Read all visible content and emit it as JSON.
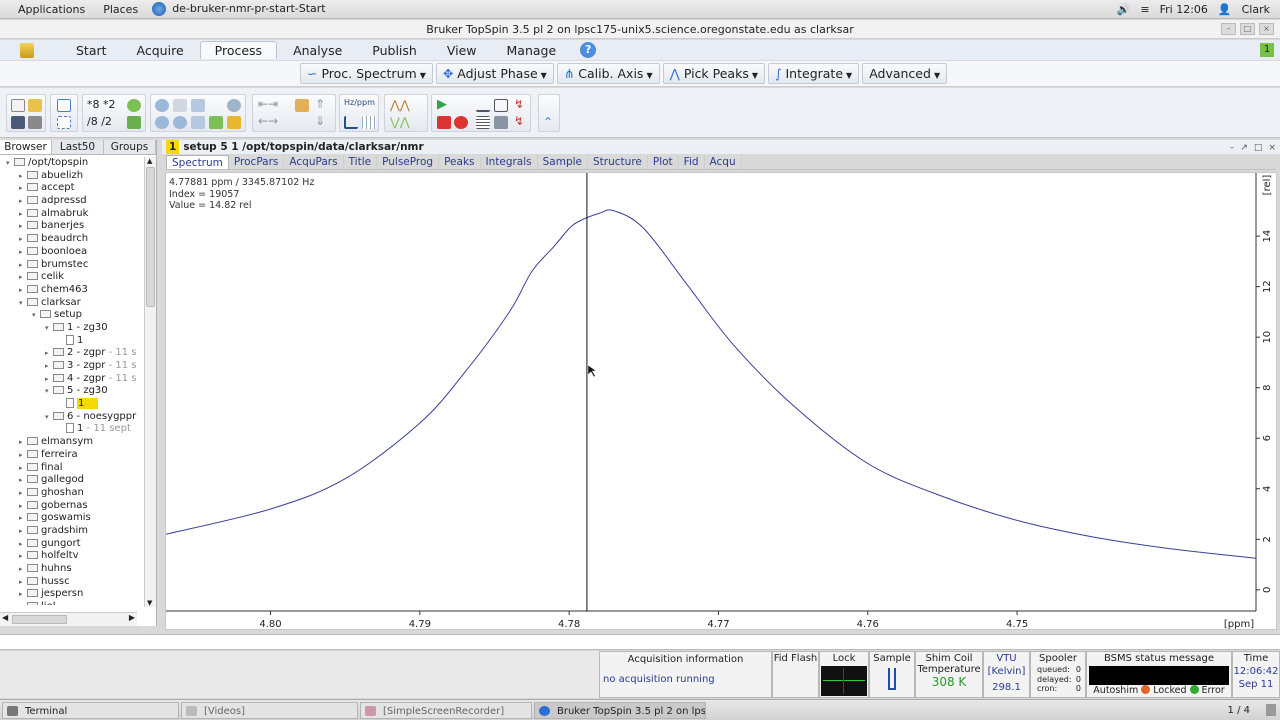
{
  "system": {
    "applications": "Applications",
    "places": "Places",
    "window_label": "de-bruker-nmr-pr-start-Start",
    "clock": "Fri 12:06",
    "user": "Clark"
  },
  "window_title": "Bruker TopSpin 3.5 pl 2 on lpsc175-unix5.science.oregonstate.edu as clarksar",
  "menu": {
    "items": [
      "Start",
      "Acquire",
      "Process",
      "Analyse",
      "Publish",
      "View",
      "Manage"
    ],
    "active": "Process",
    "help": "?",
    "corner_badge": "1"
  },
  "process_bar": [
    "Proc. Spectrum",
    "Adjust Phase",
    "Calib. Axis",
    "Pick Peaks",
    "Integrate",
    "Advanced"
  ],
  "left_tabs": [
    "Browser",
    "Last50",
    "Groups"
  ],
  "tree": [
    {
      "label": "/opt/topspin",
      "depth": 0,
      "type": "folder",
      "open": true
    },
    {
      "label": "abuelizh",
      "depth": 1,
      "type": "folder"
    },
    {
      "label": "accept",
      "depth": 1,
      "type": "folder"
    },
    {
      "label": "adpressd",
      "depth": 1,
      "type": "folder"
    },
    {
      "label": "almabruk",
      "depth": 1,
      "type": "folder"
    },
    {
      "label": "banerjes",
      "depth": 1,
      "type": "folder"
    },
    {
      "label": "beaudrch",
      "depth": 1,
      "type": "folder"
    },
    {
      "label": "boonloea",
      "depth": 1,
      "type": "folder"
    },
    {
      "label": "brumstec",
      "depth": 1,
      "type": "folder"
    },
    {
      "label": "celik",
      "depth": 1,
      "type": "folder"
    },
    {
      "label": "chem463",
      "depth": 1,
      "type": "folder"
    },
    {
      "label": "clarksar",
      "depth": 1,
      "type": "folder",
      "open": true
    },
    {
      "label": "setup",
      "depth": 2,
      "type": "folder",
      "open": true
    },
    {
      "label": "1 - zg30",
      "depth": 3,
      "type": "folder",
      "open": true
    },
    {
      "label": "1",
      "depth": 4,
      "type": "file"
    },
    {
      "label": "2 - zgpr",
      "extra": " - 11 s",
      "depth": 3,
      "type": "folder"
    },
    {
      "label": "3 - zgpr",
      "extra": " - 11 s",
      "depth": 3,
      "type": "folder"
    },
    {
      "label": "4 - zgpr",
      "extra": " - 11 s",
      "depth": 3,
      "type": "folder"
    },
    {
      "label": "5 - zg30",
      "depth": 3,
      "type": "folder",
      "open": true
    },
    {
      "label": "1",
      "depth": 4,
      "type": "file",
      "selected": true
    },
    {
      "label": "6 - noesygppr",
      "depth": 3,
      "type": "folder",
      "open": true
    },
    {
      "label": "1",
      "extra": " - 11 sept",
      "depth": 4,
      "type": "file"
    },
    {
      "label": "elmansym",
      "depth": 1,
      "type": "folder"
    },
    {
      "label": "ferreira",
      "depth": 1,
      "type": "folder"
    },
    {
      "label": "final",
      "depth": 1,
      "type": "folder"
    },
    {
      "label": "gallegod",
      "depth": 1,
      "type": "folder"
    },
    {
      "label": "ghoshan",
      "depth": 1,
      "type": "folder"
    },
    {
      "label": "gobernas",
      "depth": 1,
      "type": "folder"
    },
    {
      "label": "goswamis",
      "depth": 1,
      "type": "folder"
    },
    {
      "label": "gradshim",
      "depth": 1,
      "type": "folder"
    },
    {
      "label": "gungort",
      "depth": 1,
      "type": "folder"
    },
    {
      "label": "holfeltv",
      "depth": 1,
      "type": "folder"
    },
    {
      "label": "huhns",
      "depth": 1,
      "type": "folder"
    },
    {
      "label": "hussc",
      "depth": 1,
      "type": "folder"
    },
    {
      "label": "jespersn",
      "depth": 1,
      "type": "folder"
    },
    {
      "label": "liel",
      "depth": 1,
      "type": "folder"
    }
  ],
  "dataset": {
    "number": "1",
    "path": "setup  5  1  /opt/topspin/data/clarksar/nmr"
  },
  "data_tabs": [
    "Spectrum",
    "ProcPars",
    "AcquPars",
    "Title",
    "PulseProg",
    "Peaks",
    "Integrals",
    "Sample",
    "Structure",
    "Plot",
    "Fid",
    "Acqu"
  ],
  "cursor_info": {
    "line1": "4.77881 ppm / 3345.87102 Hz",
    "line2": "Index = 19057",
    "line3": "Value = 14.82     rel"
  },
  "chart_data": {
    "type": "line",
    "xlabel": "[ppm]",
    "ylabel": "[rel]",
    "xlim": [
      4.807,
      4.734
    ],
    "ylim": [
      -0.6,
      16.3
    ],
    "x_ticks": [
      4.8,
      4.79,
      4.78,
      4.77,
      4.76,
      4.75
    ],
    "x_tick_labels": [
      "4.80",
      "4.79",
      "4.78",
      "4.77",
      "4.76",
      "4.75"
    ],
    "y_ticks": [
      0,
      2,
      4,
      6,
      8,
      10,
      12,
      14
    ],
    "y_tick_labels": [
      "0",
      "2",
      "4",
      "6",
      "8",
      "10",
      "12",
      "14"
    ],
    "cursor_ppm": 4.77881,
    "series": [
      {
        "x": [
          4.807,
          4.8,
          4.795,
          4.79,
          4.787,
          4.784,
          4.7825,
          4.781,
          4.78,
          4.7793,
          4.778,
          4.777,
          4.775,
          4.772,
          4.769,
          4.765,
          4.76,
          4.755,
          4.75,
          4.745,
          4.74,
          4.734
        ],
        "y": [
          2.2,
          3.2,
          4.4,
          6.6,
          8.6,
          11.0,
          12.6,
          13.6,
          14.3,
          14.6,
          14.9,
          15.0,
          14.3,
          12.0,
          9.7,
          7.3,
          5.0,
          3.7,
          2.75,
          2.1,
          1.65,
          1.25
        ]
      }
    ]
  },
  "command_line": "",
  "status": {
    "acq_title": "Acquisition information",
    "acq_value": "no acquisition running",
    "fid_flash": "Fid Flash",
    "lock": "Lock",
    "sample": "Sample",
    "shim_title": "Shim Coil Temperature",
    "shim_value": "308 K",
    "vtu": "VTU",
    "vtu_unit": "[Kelvin]",
    "vtu_value": "298.1",
    "spooler": "Spooler",
    "spooler_queued": "queued:",
    "spooler_delayed": "delayed:",
    "spooler_cron": "cron:",
    "spooler_queued_val": "0",
    "spooler_delayed_val": "0",
    "spooler_cron_val": "0",
    "bsms_title": "BSMS status message",
    "autoshim": "Autoshim",
    "locked": "Locked",
    "error": "Error",
    "time_title": "Time",
    "time_value": "12:06:42",
    "date_value": "Sep 11"
  },
  "taskbar": {
    "tasks": [
      "Terminal",
      "[Videos]",
      "[SimpleScreenRecorder]",
      "Bruker TopSpin 3.5 pl 2 on lpsc..."
    ],
    "pager": "1 / 4"
  },
  "colors": {
    "spectrum": "#3a3f9a",
    "highlight": "#f5d900",
    "accent": "#4d8ee0"
  }
}
